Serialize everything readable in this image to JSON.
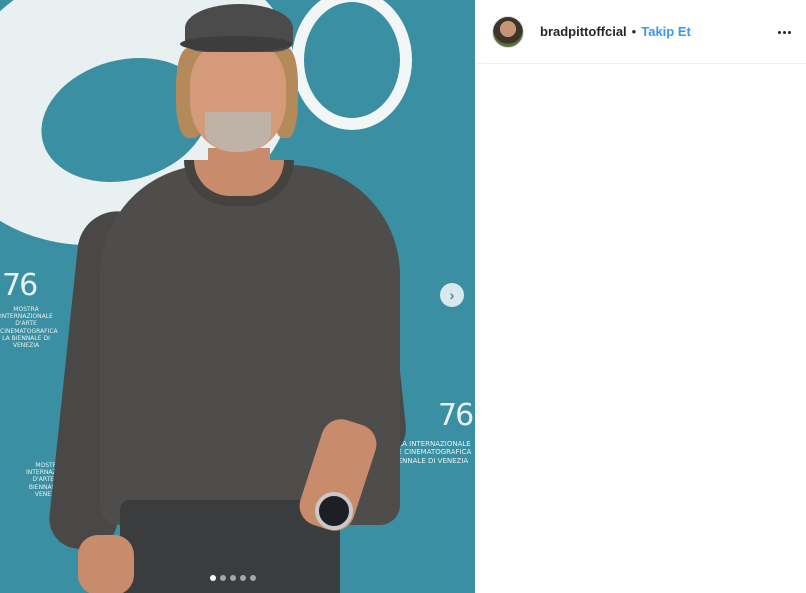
{
  "post": {
    "username": "bradpittoffcial",
    "separator": "•",
    "follow_label": "Takip Et",
    "more_icon": "more-horizontal-icon",
    "next_icon": "chevron-right-icon",
    "carousel": {
      "total": 5,
      "active_index": 0
    }
  },
  "backdrop": {
    "brand_top_left": "76",
    "brand_top_left_text": "MOSTRA INTERNAZIONALE D'ARTE CINEMATOGRAFICA LA BIENNALE DI VENEZIA",
    "brand_bottom_right": "76",
    "brand_bottom_right_text": "MOSTRA INTERNAZIONALE D'ARTE CINEMATOGRAFICA LA BIENNALE DI VENEZIA",
    "brand_bottom_left_text": "MOSTRA INTERNAZIONALE D'ARTE LA BIENNALE DI VENEZIA"
  },
  "colors": {
    "follow": "#3897f0",
    "backdrop": "#3a8fa3",
    "text": "#262626"
  }
}
